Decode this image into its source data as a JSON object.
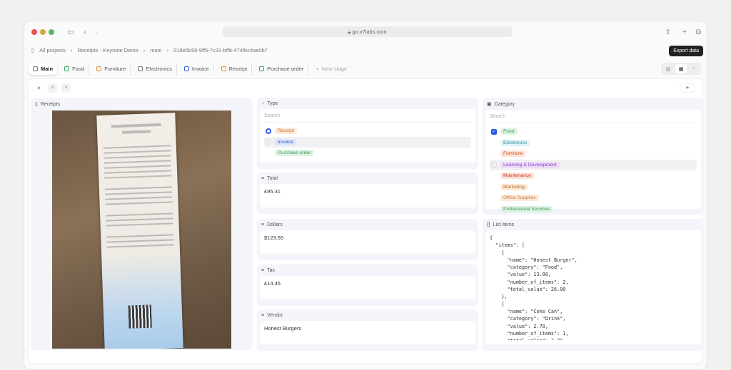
{
  "browser": {
    "url": "go.v7labs.com"
  },
  "breadcrumb": [
    "All projects",
    "Receipts - Keynote Demo",
    "main",
    "018e5b56-9ff5-7c31-bff8-474fbc4ae0b7"
  ],
  "export_tooltip": "Export data",
  "tabs": [
    {
      "label": "Main",
      "color": "#777"
    },
    {
      "label": "Food",
      "color": "#3aa55a"
    },
    {
      "label": "Furniture",
      "color": "#e08a3a"
    },
    {
      "label": "Electronics",
      "color": "#777"
    },
    {
      "label": "Invoice",
      "color": "#3b5bdb"
    },
    {
      "label": "Receipt",
      "color": "#e08a3a"
    },
    {
      "label": "Purchase order",
      "color": "#3aa55a"
    }
  ],
  "new_stage": "New stage",
  "receipts_panel": {
    "title": "Receipts"
  },
  "type": {
    "title": "Type",
    "search_placeholder": "Search",
    "options": [
      {
        "label": "Receipt",
        "selected": true,
        "bg": "#fdebd8",
        "fg": "#c0782e"
      },
      {
        "label": "Invoice",
        "selected": false,
        "bg": "#dde6fb",
        "fg": "#3452c4"
      },
      {
        "label": "Purchase order",
        "selected": false,
        "bg": "#ddf3e2",
        "fg": "#3a9a56"
      }
    ]
  },
  "total": {
    "title": "Total",
    "value": "£95.31"
  },
  "dollars": {
    "title": "Dollars",
    "value": "$123.65"
  },
  "tax": {
    "title": "Tax",
    "value": "£14.45"
  },
  "vendor": {
    "title": "Vendor",
    "value": "Honest Burgers"
  },
  "category": {
    "title": "Category",
    "search_placeholder": "Search",
    "options": [
      {
        "label": "Food",
        "checked": true,
        "bg": "#ddf3e2",
        "fg": "#3a9a56"
      },
      {
        "label": "Electronics",
        "checked": false,
        "bg": "#dcf3f8",
        "fg": "#3a8fa8"
      },
      {
        "label": "Furniture",
        "checked": false,
        "bg": "#fde4d6",
        "fg": "#c8502e"
      },
      {
        "label": "Learning & Development",
        "checked": false,
        "bg": "#eedcf9",
        "fg": "#8b3ec4"
      },
      {
        "label": "Maintenance",
        "checked": false,
        "bg": "#fde0d8",
        "fg": "#c83a2e"
      },
      {
        "label": "Marketing",
        "checked": false,
        "bg": "#fde9d8",
        "fg": "#b8702e"
      },
      {
        "label": "Office Supplies",
        "checked": false,
        "bg": "#fde9d8",
        "fg": "#c08040"
      },
      {
        "label": "Professional Services",
        "checked": false,
        "bg": "#ddf3e2",
        "fg": "#3a9a56"
      }
    ]
  },
  "list_items": {
    "title": "List items",
    "json": "{\n  \"items\": [\n    {\n      \"name\": \"Honest Burger\",\n      \"category\": \"Food\",\n      \"value\": 13.00,\n      \"number_of_items\": 2,\n      \"total_value\": 26.00\n    },\n    {\n      \"name\": \"Coke Can\",\n      \"category\": \"Drink\",\n      \"value\": 2.70,\n      \"number_of_items\": 1,\n      \"total_value\": 2.70"
  }
}
